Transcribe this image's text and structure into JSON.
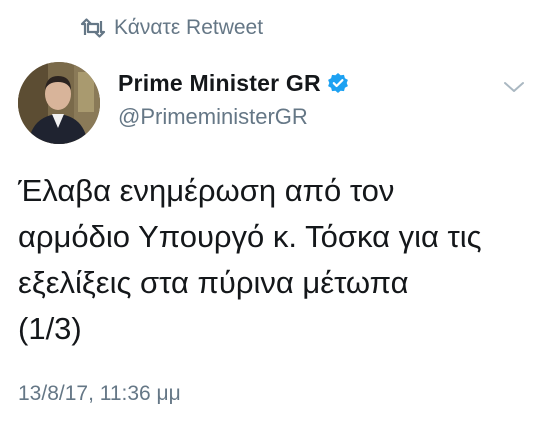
{
  "retweet": {
    "icon": "retweet-icon",
    "label": "Κάνατε Retweet"
  },
  "author": {
    "avatar_icon": "profile-photo",
    "display_name": "Prime Minister GR",
    "verified_icon": "verified-badge-icon",
    "handle": "@PrimeministerGR"
  },
  "menu": {
    "icon": "chevron-down-icon"
  },
  "tweet": {
    "text": "Έλαβα ενημέρωση από τον\nαρμόδιο Υπουργό κ. Τόσκα για τις\nεξελίξεις στα πύρινα μέτωπα\n(1/3)",
    "timestamp": "13/8/17, 11:36 μμ"
  },
  "colors": {
    "text": "#14171a",
    "secondary": "#657786",
    "verified": "#1da1f2"
  }
}
